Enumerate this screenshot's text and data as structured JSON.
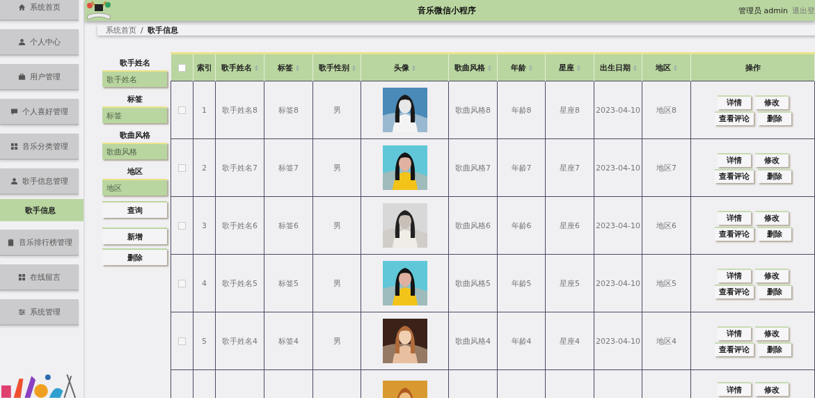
{
  "sidebar": {
    "items": [
      {
        "label": "系统首页",
        "selected": false
      },
      {
        "label": "个人中心",
        "selected": false
      },
      {
        "label": "用户管理",
        "selected": false
      },
      {
        "label": "个人喜好管理",
        "selected": false
      },
      {
        "label": "音乐分类管理",
        "selected": false
      },
      {
        "label": "歌手信息管理",
        "selected": false,
        "children": [
          {
            "label": "歌手信息",
            "selected": true
          }
        ]
      },
      {
        "label": "音乐排行榜管理",
        "selected": false
      },
      {
        "label": "在线留言",
        "selected": false
      },
      {
        "label": "系统管理",
        "selected": false
      }
    ]
  },
  "header": {
    "title": "音乐微信小程序",
    "user": "管理员 admin",
    "logout": "退出登"
  },
  "breadcrumb": {
    "items": [
      "系统首页",
      "歌手信息"
    ],
    "separator": "/"
  },
  "search": {
    "fields": [
      {
        "label": "歌手姓名",
        "placeholder": "歌手姓名"
      },
      {
        "label": "标签",
        "placeholder": "标签"
      },
      {
        "label": "歌曲风格",
        "placeholder": "歌曲风格"
      },
      {
        "label": "地区",
        "placeholder": "地区"
      }
    ],
    "query_button": "查询",
    "buttons": [
      "新增",
      "删除"
    ]
  },
  "table": {
    "select_all_checked": false,
    "columns": [
      {
        "label": "索引",
        "sortable": false
      },
      {
        "label": "歌手姓名",
        "sortable": true
      },
      {
        "label": "标签",
        "sortable": true
      },
      {
        "label": "歌手性别",
        "sortable": true
      },
      {
        "label": "头像",
        "sortable": true
      },
      {
        "label": "歌曲风格",
        "sortable": true
      },
      {
        "label": "年龄",
        "sortable": true
      },
      {
        "label": "星座",
        "sortable": true
      },
      {
        "label": "出生日期",
        "sortable": true
      },
      {
        "label": "地区",
        "sortable": true
      },
      {
        "label": "操作",
        "sortable": false
      }
    ],
    "rows": [
      {
        "kind": "full",
        "checked": false,
        "cells": [
          "1",
          "歌手姓名8",
          "标签8",
          "男",
          "歌曲风格8",
          "年龄8",
          "星座8",
          "2023-04-10",
          "地区8"
        ],
        "buttons": [
          "详情",
          "修改",
          "查看评论",
          "删除"
        ]
      },
      {
        "kind": "full",
        "checked": false,
        "cells": [
          "2",
          "歌手姓名7",
          "标签7",
          "男",
          "歌曲风格7",
          "年龄7",
          "星座7",
          "2023-04-10",
          "地区7"
        ],
        "buttons": [
          "详情",
          "修改",
          "查看评论",
          "删除"
        ]
      },
      {
        "kind": "full",
        "checked": false,
        "cells": [
          "3",
          "歌手姓名6",
          "标签6",
          "男",
          "歌曲风格6",
          "年龄6",
          "星座6",
          "2023-04-10",
          "地区6"
        ],
        "buttons": [
          "详情",
          "修改",
          "查看评论",
          "删除"
        ]
      },
      {
        "kind": "full",
        "checked": false,
        "cells": [
          "4",
          "歌手姓名5",
          "标签5",
          "男",
          "歌曲风格5",
          "年龄5",
          "星座5",
          "2023-04-10",
          "地区5"
        ],
        "buttons": [
          "详情",
          "修改",
          "查看评论",
          "删除"
        ]
      },
      {
        "kind": "full",
        "checked": false,
        "cells": [
          "5",
          "歌手姓名4",
          "标签4",
          "男",
          "歌曲风格4",
          "年龄4",
          "星座4",
          "2023-04-10",
          "地区4"
        ],
        "buttons": [
          "详情",
          "修改",
          "查看评论",
          "删除"
        ]
      },
      {
        "kind": "partial",
        "buttons": [
          "详情",
          "修改"
        ]
      }
    ]
  }
}
